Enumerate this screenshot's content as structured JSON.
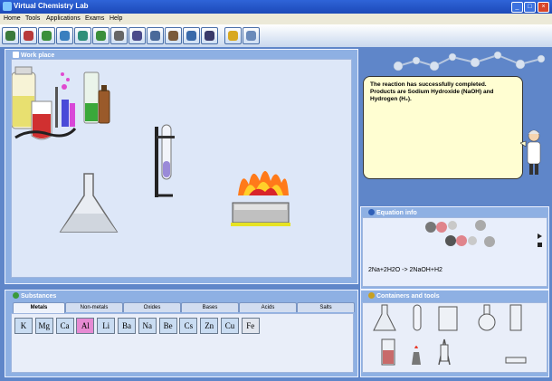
{
  "window": {
    "title": "Virtual Chemistry Lab",
    "minimize": "_",
    "maximize": "□",
    "close": "×"
  },
  "menu": [
    "Home",
    "Tools",
    "Applications",
    "Exams",
    "Help"
  ],
  "toolbar": {
    "buttons": [
      {
        "icon": "home-icon",
        "color": "#3b7a3b"
      },
      {
        "icon": "molecule-icon",
        "color": "#b83a3a"
      },
      {
        "icon": "flask-icon",
        "color": "#3b8f3b"
      },
      {
        "icon": "chart-icon",
        "color": "#3a7fbf"
      },
      {
        "icon": "beaker-icon",
        "color": "#2f8f7a"
      },
      {
        "icon": "leaf-icon",
        "color": "#3b8f3b"
      },
      {
        "icon": "clock-icon",
        "color": "#666666"
      },
      {
        "icon": "document-icon",
        "color": "#4a4a8a"
      },
      {
        "icon": "table-icon",
        "color": "#4a6a9a"
      },
      {
        "icon": "animal-icon",
        "color": "#7a5a3a"
      },
      {
        "icon": "edit-icon",
        "color": "#3a6aaa"
      },
      {
        "icon": "screen-icon",
        "color": "#3a3a6a"
      },
      {
        "icon": "bulb-icon",
        "color": "#d8a820"
      },
      {
        "icon": "chat-icon",
        "color": "#6a8aba"
      }
    ]
  },
  "workplace": {
    "title": "Work place"
  },
  "message": {
    "line1": "The reaction has successfully completed.",
    "line2": "Products are Sodium Hydroxide (NaOH) and",
    "line3": "Hydrogen (H₂)."
  },
  "equation_info": {
    "title": "Equation info",
    "equation": "2Na+2H2O -> 2NaOH+H2"
  },
  "substances": {
    "title": "Substances",
    "tabs": [
      "Metals",
      "Non-metals",
      "Oxides",
      "Bases",
      "Acids",
      "Salts"
    ],
    "active_tab": "Metals",
    "elements": [
      "K",
      "Mg",
      "Ca",
      "Al",
      "Li",
      "Ba",
      "Na",
      "Be",
      "Cs",
      "Zn",
      "Cu",
      "Fe"
    ],
    "highlighted": "Al"
  },
  "containers": {
    "title": "Containers and tools"
  },
  "colors": {
    "titlebar": "#2f64d8",
    "panel": "#8eb0e3",
    "highlight": "#e68ad3",
    "bubble": "#fffed2"
  }
}
